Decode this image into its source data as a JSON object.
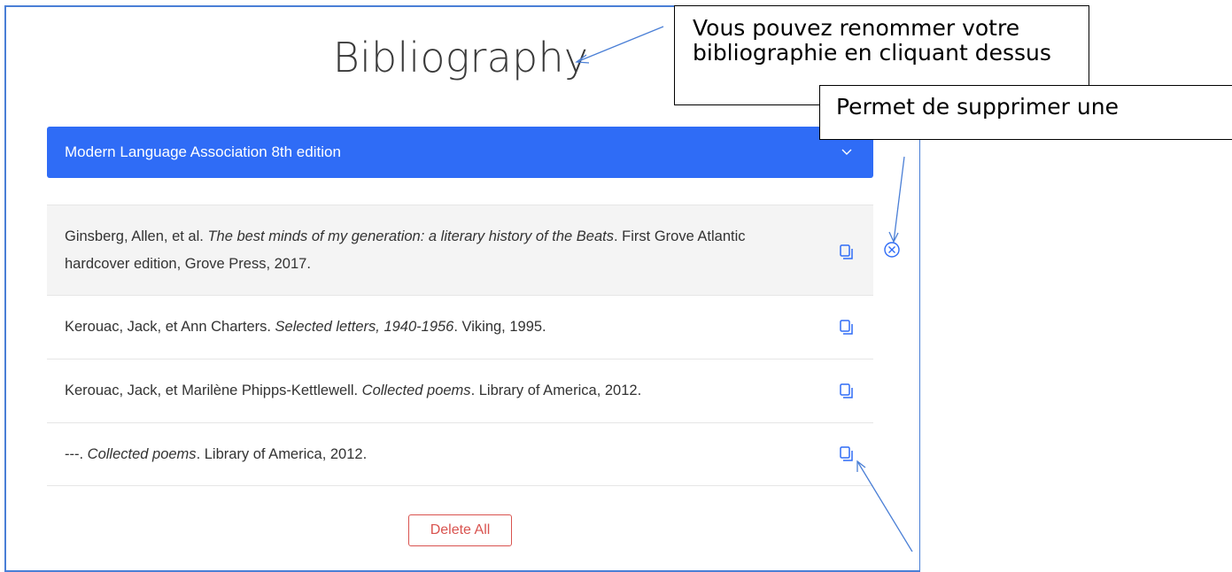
{
  "bibliography": {
    "title": "Bibliography",
    "style_select": {
      "selected": "Modern Language Association 8th edition"
    },
    "entries": [
      {
        "author": "Ginsberg, Allen, et al. ",
        "title": "The best minds of my generation: a literary history of the Beats",
        "rest": ". First Grove Atlantic hardcover edition, Grove Press, 2017."
      },
      {
        "author": "Kerouac, Jack, et Ann Charters. ",
        "title": "Selected letters, 1940-1956",
        "rest": ". Viking, 1995."
      },
      {
        "author": "Kerouac, Jack, et Marilène Phipps-Kettlewell. ",
        "title": "Collected poems",
        "rest": ". Library of America, 2012."
      },
      {
        "author": "---. ",
        "title": "Collected poems",
        "rest": ". Library of America, 2012."
      }
    ],
    "delete_all_label": "Delete All"
  },
  "annotations": {
    "rename_note": "Vous pouvez renommer votre bibliographie en cliquant dessus",
    "delete_note": "Permet de supprimer une"
  },
  "icons": {
    "chevron": "chevron-down-icon",
    "copy": "copy-icon",
    "remove": "remove-circle-icon"
  },
  "colors": {
    "accent": "#2f6cf6",
    "danger": "#d9534f",
    "annotation_arrow": "#4a7fd6"
  }
}
